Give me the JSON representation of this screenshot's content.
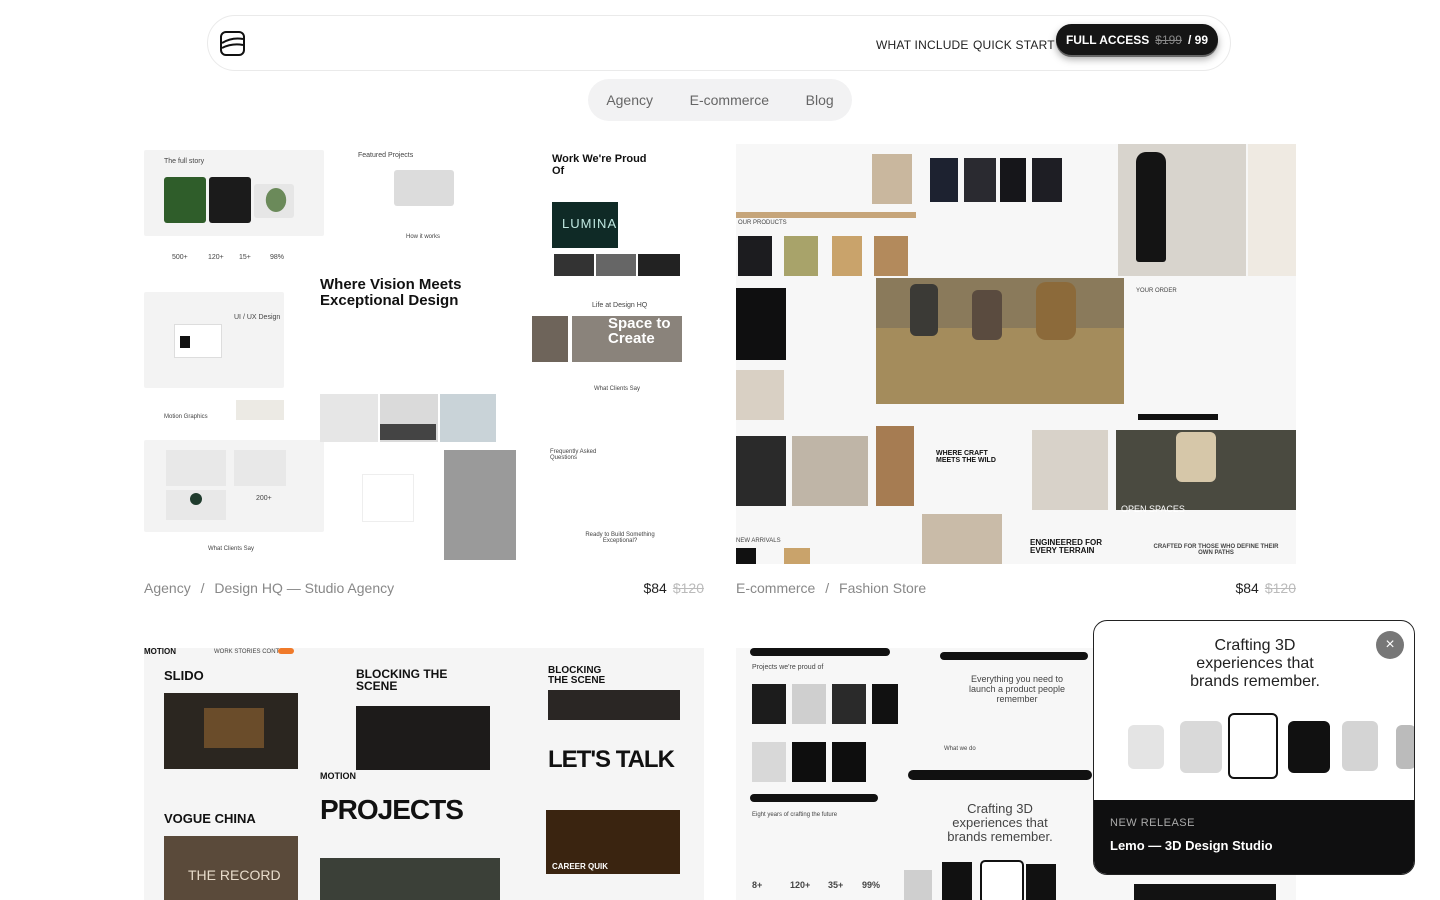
{
  "header": {
    "nav": [
      "WHAT INCLUDE",
      "QUICK START"
    ],
    "cta": {
      "label": "FULL ACCESS",
      "old_price": "$199",
      "price": "/ 99"
    }
  },
  "categories": [
    "Agency",
    "E-commerce",
    "Blog"
  ],
  "products": [
    {
      "category": "Agency",
      "sep": "/",
      "name": "Design HQ — Studio Agency",
      "price": "$84",
      "old_price": "$120",
      "thumb_text": {
        "story": "The full story",
        "featured": "Featured Projects",
        "proud": "Work We're Proud Of",
        "vision": "Where Vision Meets Exceptional Design",
        "how": "How it works",
        "life": "Life at Design HQ",
        "space": "Space to Create",
        "lumina": "LUMINA",
        "uiux": "UI / UX Design",
        "motion": "Motion Graphics",
        "clients": "What Clients Say",
        "faq": "Frequently Asked Questions",
        "ready": "Ready to Build Something Exceptional?",
        "stats": [
          "500+",
          "120+",
          "15+",
          "98%"
        ],
        "stat200": "200+"
      }
    },
    {
      "category": "E-commerce",
      "sep": "/",
      "name": "Fashion Store",
      "price": "$84",
      "old_price": "$120",
      "thumb_text": {
        "craft": "WHERE CRAFT MEETS THE WILD",
        "open": "OPEN SPACES",
        "terrain": "ENGINEERED FOR EVERY TERRAIN",
        "crafted": "CRAFTED FOR THOSE WHO DEFINE THEIR OWN PATHS",
        "order": "YOUR ORDER",
        "products": "OUR PRODUCTS",
        "arrivals": "NEW ARRIVALS"
      }
    },
    {
      "thumb_text": {
        "motion": "MOTION",
        "slido": "SLIDO",
        "blocking": "BLOCKING THE SCENE",
        "talk": "LET'S TALK",
        "vogue": "VOGUE CHINA",
        "projects": "PROJECTS",
        "record": "THE RECORD",
        "career": "CAREER QUIK",
        "nav": "WORK  STORIES  CONTACT"
      }
    },
    {
      "thumb_text": {
        "proud": "Projects we're proud of",
        "everything": "Everything you need to launch a product people remember",
        "crafting": "Crafting 3D experiences that brands remember.",
        "whatwedo": "What we do",
        "eight": "Eight years of crafting the future",
        "stats": [
          "8+",
          "120+",
          "35+",
          "99%"
        ]
      }
    }
  ],
  "popup": {
    "headline": [
      "Crafting 3D",
      "experiences that",
      "brands remember."
    ],
    "tag": "NEW RELEASE",
    "title": "Lemo — 3D Design Studio",
    "close": "×"
  },
  "colors": {
    "accent": "#111111",
    "orange": "#f07a2a"
  }
}
